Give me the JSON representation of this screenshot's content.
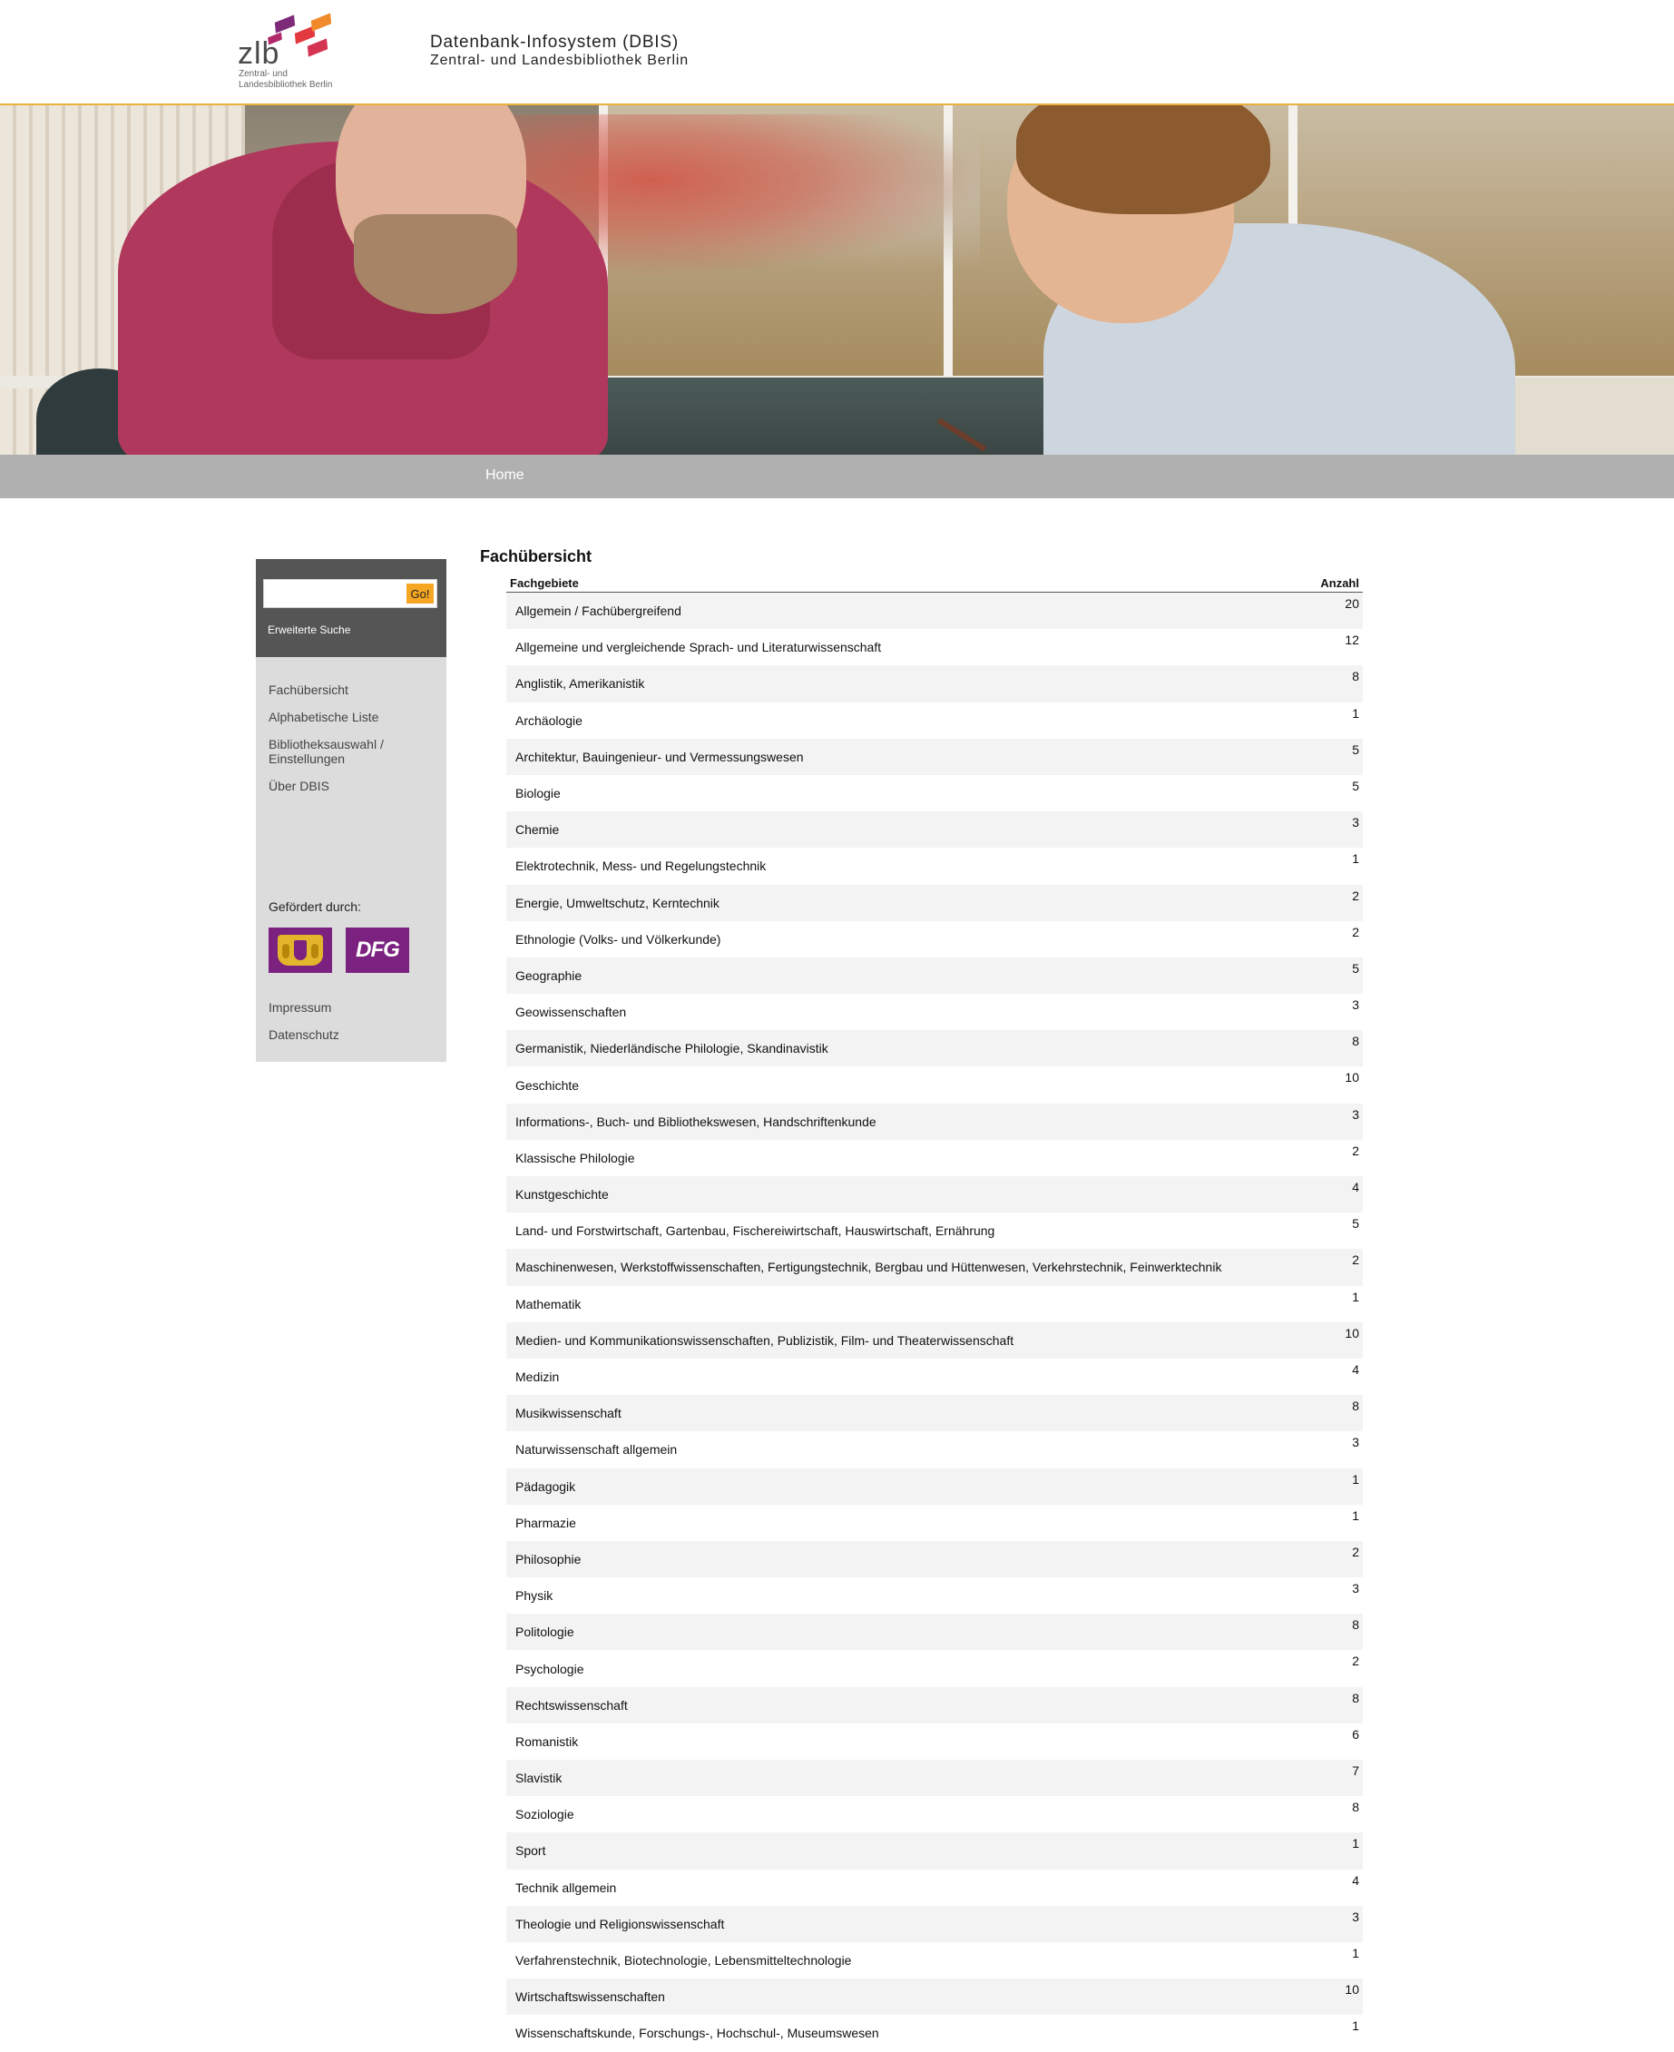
{
  "header": {
    "logo_word": "zlb",
    "logo_sub1": "Zentral- und",
    "logo_sub2": "Landesbibliothek Berlin",
    "title": "Datenbank-Infosystem (DBIS)",
    "subtitle": "Zentral- und Landesbibliothek Berlin"
  },
  "colors": {
    "accent": "#f5a623",
    "header_rule": "#e8b23c",
    "nav_bar": "#b0b0b0",
    "sidebar_bg": "#dcdcdc",
    "search_bg": "#555555",
    "funder_purple": "#7b2280"
  },
  "nav": {
    "home": "Home"
  },
  "search": {
    "placeholder": "",
    "value": "",
    "go_label": "Go!",
    "advanced_label": "Erweiterte Suche"
  },
  "sidebar": {
    "items": [
      {
        "label": "Fachübersicht"
      },
      {
        "label": "Alphabetische Liste"
      },
      {
        "label": "Bibliotheksauswahl / Einstellungen"
      },
      {
        "label": "Über DBIS"
      }
    ],
    "funded_label": "Gefördert durch:",
    "funders": [
      {
        "name": "bavaria-crest-icon"
      },
      {
        "name": "DFG"
      }
    ],
    "legal": [
      {
        "label": "Impressum"
      },
      {
        "label": "Datenschutz"
      }
    ]
  },
  "main": {
    "title": "Fachübersicht",
    "columns": {
      "subject": "Fachgebiete",
      "count": "Anzahl"
    },
    "rows": [
      {
        "subject": "Allgemein / Fachübergreifend",
        "count": "20"
      },
      {
        "subject": "Allgemeine und vergleichende Sprach- und Literaturwissenschaft",
        "count": "12"
      },
      {
        "subject": "Anglistik, Amerikanistik",
        "count": "8"
      },
      {
        "subject": "Archäologie",
        "count": "1"
      },
      {
        "subject": "Architektur, Bauingenieur- und Vermessungswesen",
        "count": "5"
      },
      {
        "subject": "Biologie",
        "count": "5"
      },
      {
        "subject": "Chemie",
        "count": "3"
      },
      {
        "subject": "Elektrotechnik, Mess- und Regelungstechnik",
        "count": "1"
      },
      {
        "subject": "Energie, Umweltschutz, Kerntechnik",
        "count": "2"
      },
      {
        "subject": "Ethnologie (Volks- und Völkerkunde)",
        "count": "2"
      },
      {
        "subject": "Geographie",
        "count": "5"
      },
      {
        "subject": "Geowissenschaften",
        "count": "3"
      },
      {
        "subject": "Germanistik, Niederländische Philologie, Skandinavistik",
        "count": "8"
      },
      {
        "subject": "Geschichte",
        "count": "10"
      },
      {
        "subject": "Informations-, Buch- und Bibliothekswesen, Handschriftenkunde",
        "count": "3"
      },
      {
        "subject": "Klassische Philologie",
        "count": "2"
      },
      {
        "subject": "Kunstgeschichte",
        "count": "4"
      },
      {
        "subject": "Land- und Forstwirtschaft, Gartenbau, Fischereiwirtschaft, Hauswirtschaft, Ernährung",
        "count": "5"
      },
      {
        "subject": "Maschinenwesen, Werkstoffwissenschaften, Fertigungstechnik, Bergbau und Hüttenwesen, Verkehrstechnik, Feinwerktechnik",
        "count": "2"
      },
      {
        "subject": "Mathematik",
        "count": "1"
      },
      {
        "subject": "Medien- und Kommunikationswissenschaften, Publizistik, Film- und Theaterwissenschaft",
        "count": "10"
      },
      {
        "subject": "Medizin",
        "count": "4"
      },
      {
        "subject": "Musikwissenschaft",
        "count": "8"
      },
      {
        "subject": "Naturwissenschaft allgemein",
        "count": "3"
      },
      {
        "subject": "Pädagogik",
        "count": "1"
      },
      {
        "subject": "Pharmazie",
        "count": "1"
      },
      {
        "subject": "Philosophie",
        "count": "2"
      },
      {
        "subject": "Physik",
        "count": "3"
      },
      {
        "subject": "Politologie",
        "count": "8"
      },
      {
        "subject": "Psychologie",
        "count": "2"
      },
      {
        "subject": "Rechtswissenschaft",
        "count": "8"
      },
      {
        "subject": "Romanistik",
        "count": "6"
      },
      {
        "subject": "Slavistik",
        "count": "7"
      },
      {
        "subject": "Soziologie",
        "count": "8"
      },
      {
        "subject": "Sport",
        "count": "1"
      },
      {
        "subject": "Technik allgemein",
        "count": "4"
      },
      {
        "subject": "Theologie und Religionswissenschaft",
        "count": "3"
      },
      {
        "subject": "Verfahrenstechnik, Biotechnologie, Lebensmitteltechnologie",
        "count": "1"
      },
      {
        "subject": "Wirtschaftswissenschaften",
        "count": "10"
      },
      {
        "subject": "Wissenschaftskunde, Forschungs-, Hochschul-, Museumswesen",
        "count": "1"
      }
    ]
  }
}
